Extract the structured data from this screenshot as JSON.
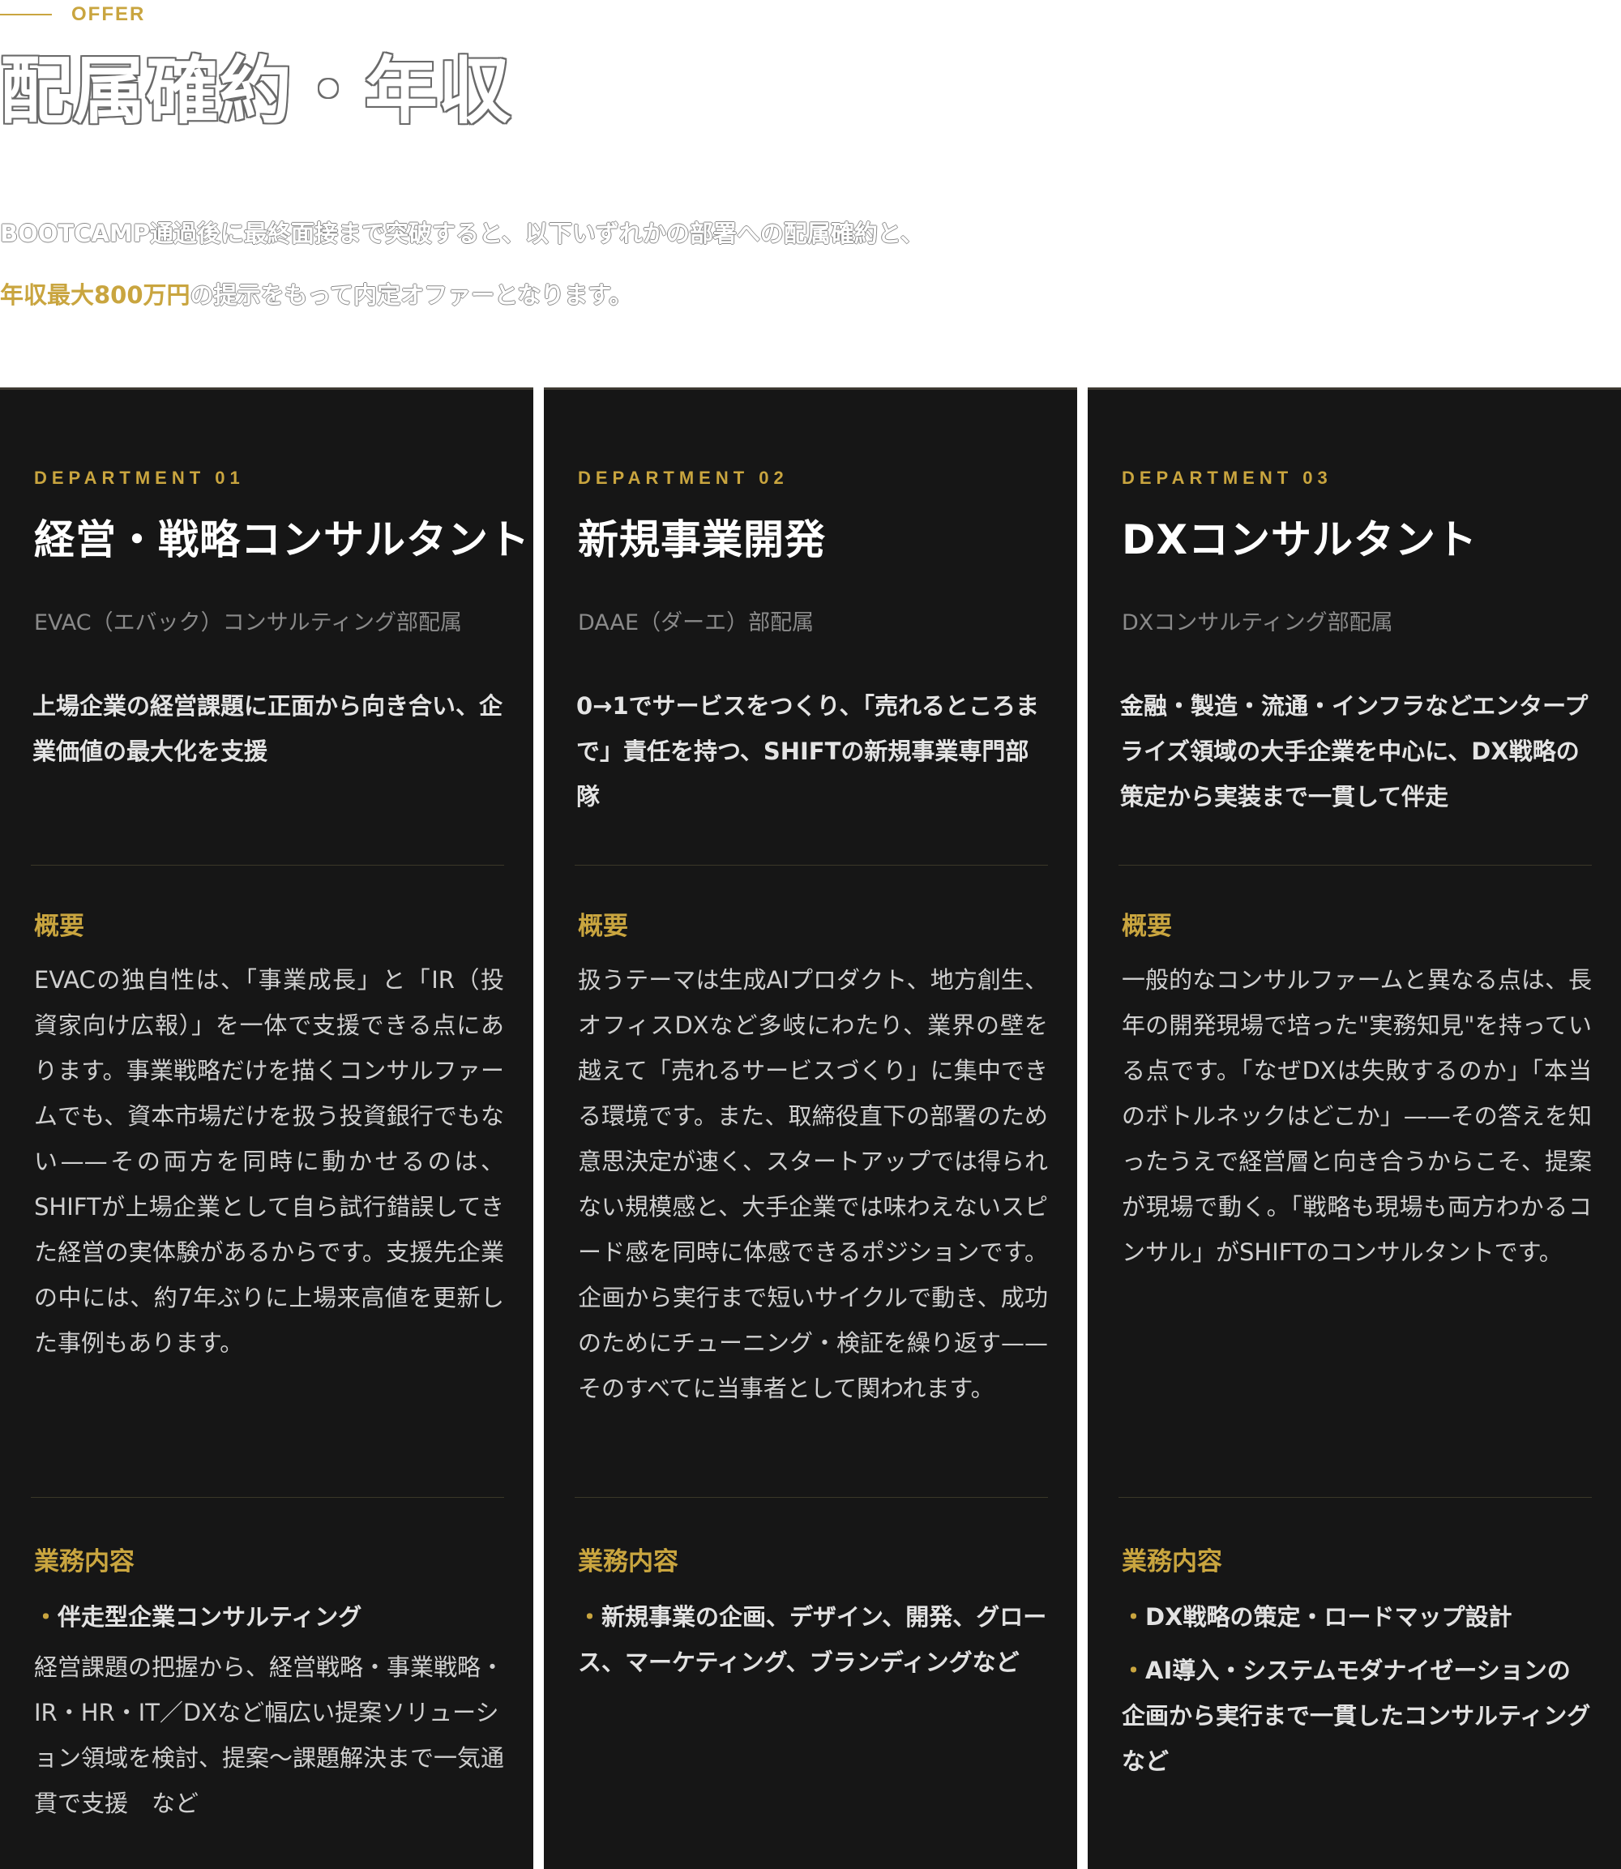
{
  "section_label": "OFFER",
  "heading": "配属確約・年収",
  "intro": {
    "line1": "BOOTCAMP通過後に最終面接まで突破すると、以下いずれかの部署への配属確約と、",
    "highlight": "年収最大800万円",
    "line2_rest": "の提示をもって内定オファーとなります。"
  },
  "departments": [
    {
      "number": "DEPARTMENT 01",
      "title": "経営・戦略コンサルタント",
      "subtitle": "EVAC（エバック）コンサルティング部配属",
      "lead": "上場企業の経営課題に正面から向き合い、企業価値の最大化を支援",
      "overview_title": "概要",
      "overview": "EVACの独自性は、「事業成長」と「IR（投資家向け広報）」を一体で支援できる点にあります。事業戦略だけを描くコンサルファームでも、資本市場だけを扱う投資銀行でもない——その両方を同時に動かせるのは、SHIFTが上場企業として自ら試行錯誤してきた経営の実体験があるからです。支援先企業の中には、約7年ぶりに上場来高値を更新した事例もあります。",
      "duties_title": "業務内容",
      "duties": [
        {
          "item": "伴走型企業コンサルティング",
          "desc": "経営課題の把握から、経営戦略・事業戦略・IR・HR・IT／DXなど幅広い提案ソリューション領域を検討、提案〜課題解決まで一気通貫で支援　など"
        }
      ]
    },
    {
      "number": "DEPARTMENT 02",
      "title": "新規事業開発",
      "subtitle": "DAAE（ダーエ）部配属",
      "lead": "0→1でサービスをつくり、「売れるところまで」責任を持つ、SHIFTの新規事業専門部隊",
      "overview_title": "概要",
      "overview": "扱うテーマは生成AIプロダクト、地方創生、オフィスDXなど多岐にわたり、業界の壁を越えて「売れるサービスづくり」に集中できる環境です。また、取締役直下の部署のため意思決定が速く、スタートアップでは得られない規模感と、大手企業では味わえないスピード感を同時に体感できるポジションです。企画から実行まで短いサイクルで動き、成功のためにチューニング・検証を繰り返す——そのすべてに当事者として関われます。",
      "duties_title": "業務内容",
      "duties": [
        {
          "item": "新規事業の企画、デザイン、開発、グロース、マーケティング、ブランディングなど",
          "desc": ""
        }
      ]
    },
    {
      "number": "DEPARTMENT 03",
      "title": "DXコンサルタント",
      "subtitle": "DXコンサルティング部配属",
      "lead": "金融・製造・流通・インフラなどエンタープライズ領域の大手企業を中心に、DX戦略の策定から実装まで一貫して伴走",
      "overview_title": "概要",
      "overview": "一般的なコンサルファームと異なる点は、長年の開発現場で培った\"実務知見\"を持っている点です。「なぜDXは失敗するのか」「本当のボトルネックはどこか」——その答えを知ったうえで経営層と向き合うからこそ、提案が現場で動く。「戦略も現場も両方わかるコンサル」がSHIFTのコンサルタントです。",
      "duties_title": "業務内容",
      "duties": [
        {
          "item": "DX戦略の策定・ロードマップ設計",
          "desc": ""
        },
        {
          "item": "AI導入・システムモダナイゼーションの企画から実行まで一貫したコンサルティング　など",
          "desc": ""
        }
      ]
    }
  ],
  "bullet": "・",
  "colors": {
    "accent": "#c9a53f",
    "card_bg": "#161616",
    "page_bg": "#ffffff"
  }
}
